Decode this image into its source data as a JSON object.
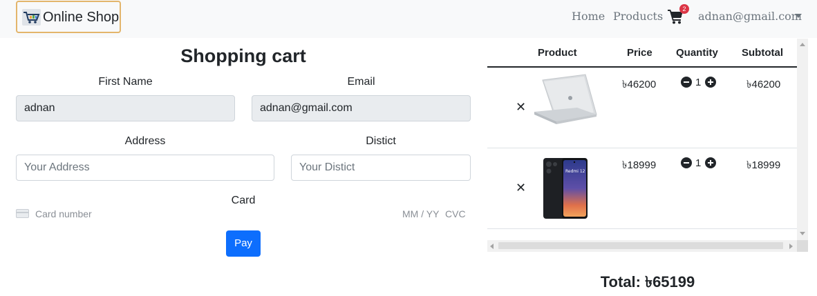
{
  "navbar": {
    "brand": "Online Shop",
    "links": [
      "Home",
      "Products"
    ],
    "cart_count": "2",
    "user_email": "adnan@gmail.com"
  },
  "form": {
    "title": "Shopping cart",
    "first_name_label": "First Name",
    "first_name_value": "adnan",
    "email_label": "Email",
    "email_value": "adnan@gmail.com",
    "address_label": "Address",
    "address_placeholder": "Your Address",
    "district_label": "Distict",
    "district_placeholder": "Your Distict",
    "card_label": "Card",
    "card_number_placeholder": "Card number",
    "card_expiry_placeholder": "MM / YY",
    "card_cvc_placeholder": "CVC",
    "pay_label": "Pay"
  },
  "cart_table": {
    "headers": [
      "Product",
      "Price",
      "Quantity",
      "Subtotal"
    ],
    "remove_symbol": "✕",
    "rows": [
      {
        "product": "laptop",
        "price": "৳46200",
        "quantity": "1",
        "subtotal": "৳46200"
      },
      {
        "product": "Redmi 12",
        "price": "৳18999",
        "quantity": "1",
        "subtotal": "৳18999"
      }
    ]
  },
  "total": "Total: ৳65199",
  "colors": {
    "primary": "#0d6efd",
    "badge": "#dc3545",
    "brand_border": "#e3b56b",
    "navbar_bg": "#f8f9fa"
  },
  "icons": [
    "cart-icon",
    "caret-down-icon",
    "card-icon",
    "minus-circle-icon",
    "plus-circle-icon",
    "close-icon"
  ]
}
